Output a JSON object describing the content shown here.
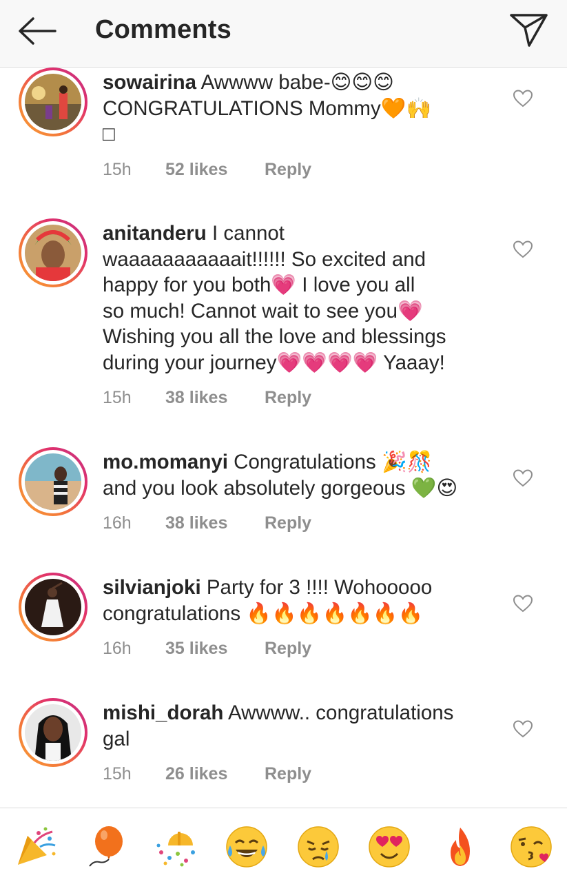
{
  "header": {
    "title": "Comments",
    "back_icon": "arrow-left-icon",
    "send_icon": "paper-plane-icon"
  },
  "comments": [
    {
      "username": "sowairina",
      "lines": [
        "Awwww babe-😊😊😊",
        "CONGRATULATIONS Mommy🧡🙌",
        "□"
      ],
      "time": "15h",
      "likes": "52 likes",
      "reply": "Reply"
    },
    {
      "username": "anitanderu",
      "lines": [
        "I cannot",
        "waaaaaaaaaaait!!!!!! So excited and",
        "happy for you both💗 I love you all",
        "so much! Cannot wait to see you💗",
        "Wishing you all the love and blessings",
        "during your journey💗💗💗💗 Yaaay!"
      ],
      "time": "15h",
      "likes": "38 likes",
      "reply": "Reply"
    },
    {
      "username": "mo.momanyi",
      "lines": [
        "Congratulations 🎉🎊",
        "and you look absolutely gorgeous 💚😍"
      ],
      "time": "16h",
      "likes": "38 likes",
      "reply": "Reply"
    },
    {
      "username": "silvianjoki",
      "lines": [
        "Party for 3 !!!! Wohooooo",
        "congratulations 🔥🔥🔥🔥🔥🔥🔥"
      ],
      "time": "16h",
      "likes": "35 likes",
      "reply": "Reply"
    },
    {
      "username": "mishi_dorah",
      "lines": [
        "Awwww.. congratulations",
        "gal"
      ],
      "time": "15h",
      "likes": "26 likes",
      "reply": "Reply"
    }
  ],
  "emoji_bar": [
    "🎉",
    "🎈",
    "🎊",
    "😂",
    "😢",
    "😍",
    "🔥",
    "😘"
  ],
  "colors": {
    "text": "#262626",
    "muted": "#8e8e8e",
    "header_bg": "#f8f8f8",
    "ring_start": "#f9a135",
    "ring_end": "#c13584"
  }
}
